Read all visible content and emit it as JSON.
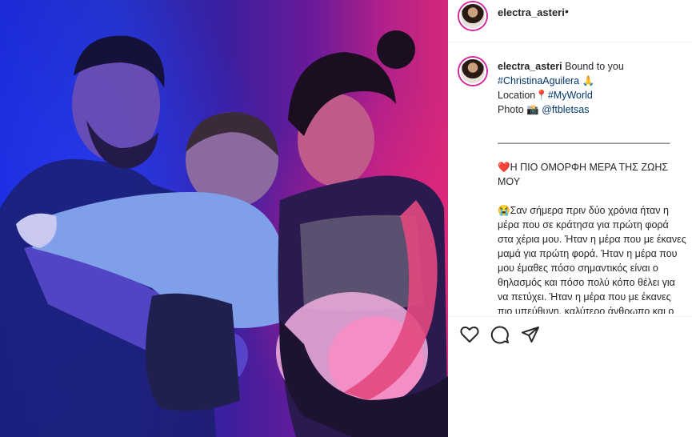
{
  "post": {
    "username": "electra_asteri",
    "header_dot": "•",
    "caption": {
      "lead": "Bound to you",
      "hashtag1": "#ChristinaAguilera",
      "emoji_hands": "🙏",
      "location_label": "Location",
      "location_emoji": "📍",
      "hashtag2": "#MyWorld",
      "photo_label": "Photo",
      "photo_emoji": "📸",
      "photographer": "@ftbletsas",
      "separator": "_______________________________",
      "heart_emoji": "❤️",
      "headline": "Η ΠΙΟ ΟΜΟΡΦΗ ΜΕΡΑ ΤΗΣ ΖΩΗΣ ΜΟΥ",
      "tear_emoji": "😭",
      "body": "Σαν σήμερα πριν δύο χρόνια ήταν η μέρα που σε κράτησα για πρώτη φορά στα χέρια μου. Ήταν η μέρα που με έκανες μαμά για πρώτη φορά. Ήταν η μέρα που μου έμαθες πόσο σημαντικός είναι ο θηλασμός και πόσο πολύ κόπο θέλει για να πετύχει. Ήταν η μέρα που με έκανες πιο υπεύθυνη, καλύτερο άνθρωπο και ο"
    }
  },
  "icons": {
    "like": "heart-outline-icon",
    "comment": "comment-bubble-icon",
    "share": "paper-plane-icon"
  },
  "colors": {
    "link": "#00376b",
    "text": "#262626",
    "story_ring": "#d6249f",
    "photo_blue": "#1a2ad8",
    "photo_pink": "#d4287a"
  }
}
